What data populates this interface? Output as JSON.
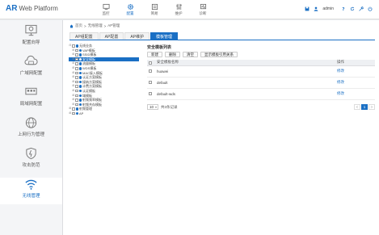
{
  "brand": {
    "ar": "AR",
    "rest": "Web Platform"
  },
  "nav": [
    {
      "label": "监控",
      "icon": "monitor-icon"
    },
    {
      "label": "配置",
      "icon": "gear-icon"
    },
    {
      "label": "简易",
      "icon": "tools-icon"
    },
    {
      "label": "维护",
      "icon": "sliders-icon"
    },
    {
      "label": "诊断",
      "icon": "diagnose-icon"
    }
  ],
  "top_user": "admin",
  "sidebar": [
    {
      "label": "配置向导",
      "icon": "wizard-icon"
    },
    {
      "label": "广域网配置",
      "icon": "wan-cloud-icon"
    },
    {
      "label": "局域网配置",
      "icon": "lan-icon"
    },
    {
      "label": "上网行为管理",
      "icon": "globe-icon"
    },
    {
      "label": "攻击防范",
      "icon": "shield-icon"
    },
    {
      "label": "无线管理",
      "icon": "wifi-icon"
    }
  ],
  "breadcrumb": [
    "首页",
    "无线管理",
    "AP管理"
  ],
  "tabs": [
    "AP组配置",
    "AP配置",
    "AP维护",
    "模板管理"
  ],
  "tree": [
    {
      "label": "无线业务",
      "level": 0,
      "exp": "⊟"
    },
    {
      "label": "VAP模板",
      "level": 1,
      "exp": "⊞"
    },
    {
      "label": "SSID模板",
      "level": 1,
      "exp": "⊞"
    },
    {
      "label": "安全模板",
      "level": 1,
      "exp": "⊞",
      "selected": true
    },
    {
      "label": "流量模板",
      "level": 1,
      "exp": "⊞"
    },
    {
      "label": "WDS模板",
      "level": 1,
      "exp": "⊞"
    },
    {
      "label": "MAC接入模板",
      "level": 1,
      "exp": "⊞"
    },
    {
      "label": "认证方案模板",
      "level": 1,
      "exp": "⊞"
    },
    {
      "label": "接纳方案模板",
      "level": 1,
      "exp": "⊞"
    },
    {
      "label": "计费方案模板",
      "level": 1,
      "exp": "⊞"
    },
    {
      "label": "认证模板",
      "level": 1,
      "exp": "⊞"
    },
    {
      "label": "域模板",
      "level": 1,
      "exp": "⊞"
    },
    {
      "label": "射频频率模板",
      "level": 1,
      "exp": "⊞"
    },
    {
      "label": "射频共存模板",
      "level": 1,
      "exp": "⊞"
    },
    {
      "label": "射频管理",
      "level": 0,
      "exp": "⊞"
    },
    {
      "label": "AP",
      "level": 0,
      "exp": "⊞"
    }
  ],
  "content": {
    "title": "安全模板列表",
    "buttons": [
      "新建",
      "删除",
      "清空",
      "显示模板引用关系"
    ],
    "columns": [
      "安全模板名称",
      "操作"
    ],
    "rows": [
      {
        "name": "huawei",
        "op": "修改"
      },
      {
        "name": "default",
        "op": "修改"
      },
      {
        "name": "default-wds",
        "op": "修改"
      }
    ],
    "page_size": "10",
    "total_text": "共3条记录",
    "pager": [
      "<",
      "1",
      ">"
    ]
  },
  "colors": {
    "accent": "#1a6fc4"
  }
}
